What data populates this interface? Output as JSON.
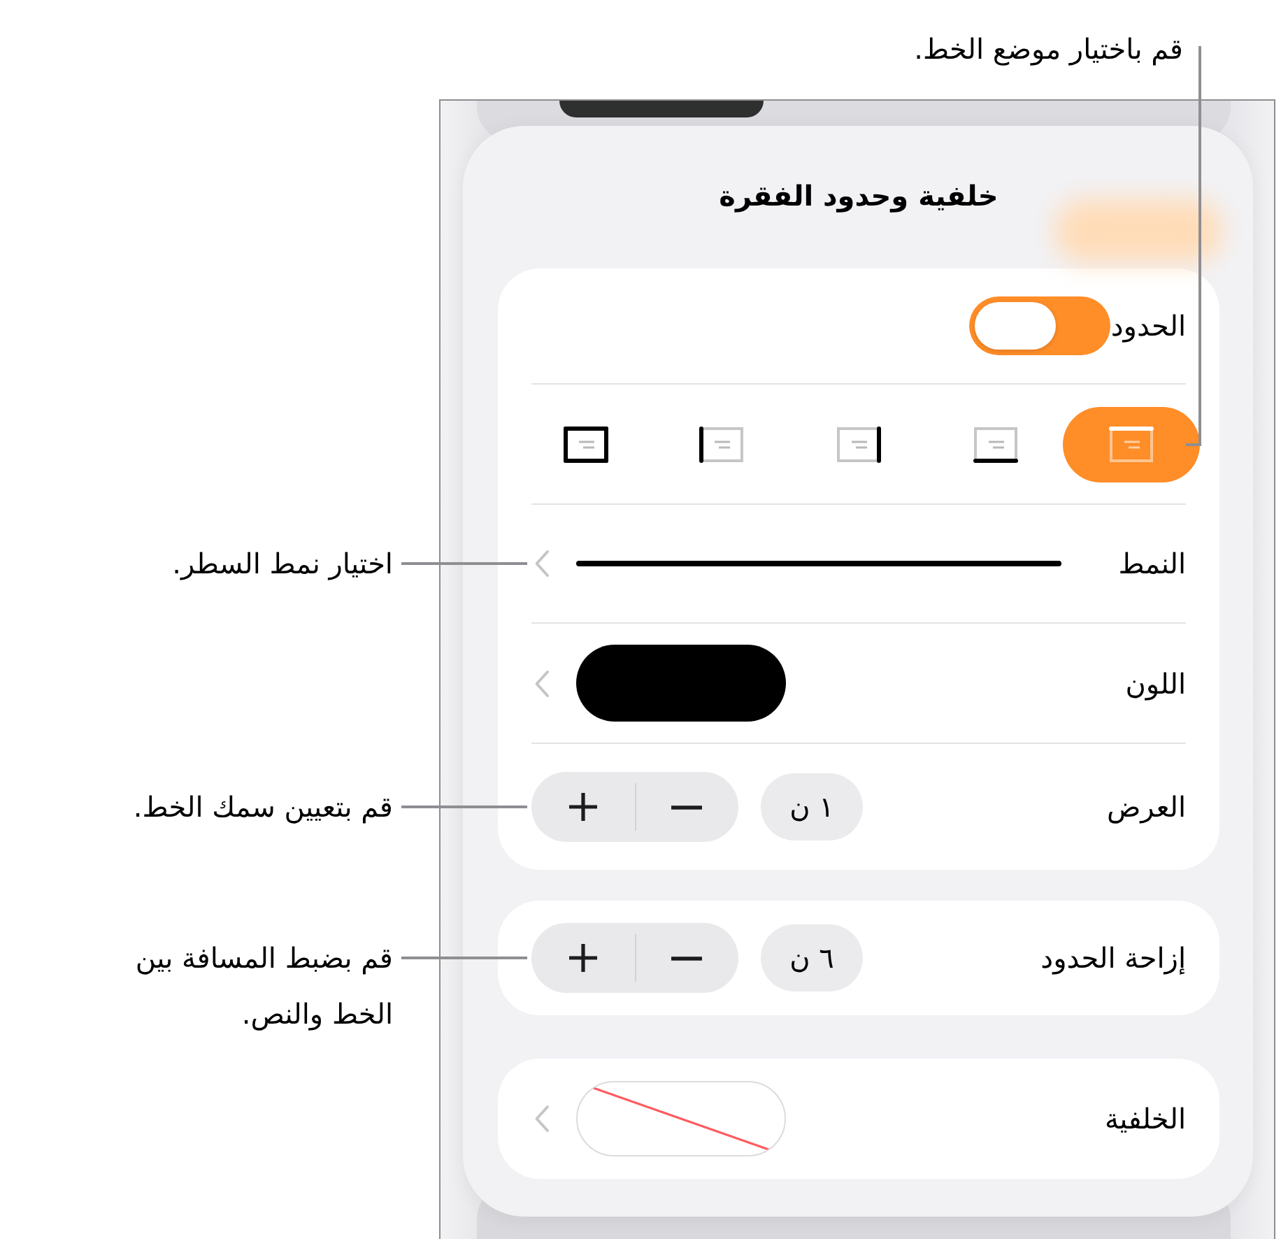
{
  "panel": {
    "title": "خلفية وحدود الفقرة",
    "borders": {
      "label": "الحدود",
      "on": true
    },
    "positions": {
      "callout": "قم باختيار موضع الخط.",
      "options": [
        {
          "kind": "top",
          "selected": true
        },
        {
          "kind": "bottom",
          "selected": false
        },
        {
          "kind": "right",
          "selected": false
        },
        {
          "kind": "left",
          "selected": false
        },
        {
          "kind": "all",
          "selected": false
        }
      ]
    },
    "style": {
      "label": "النمط",
      "callout": "اختيار نمط السطر."
    },
    "color": {
      "label": "اللون",
      "color": "#000000"
    },
    "width": {
      "label": "العرض",
      "value": "١ ن",
      "callout": "قم بتعيين سمك الخط."
    },
    "offset": {
      "label": "إزاحة الحدود",
      "value": "٦ ن",
      "callout": "قم بضبط المسافة بين الخط والنص."
    },
    "background": {
      "label": "الخلفية",
      "no_fill": true
    }
  }
}
